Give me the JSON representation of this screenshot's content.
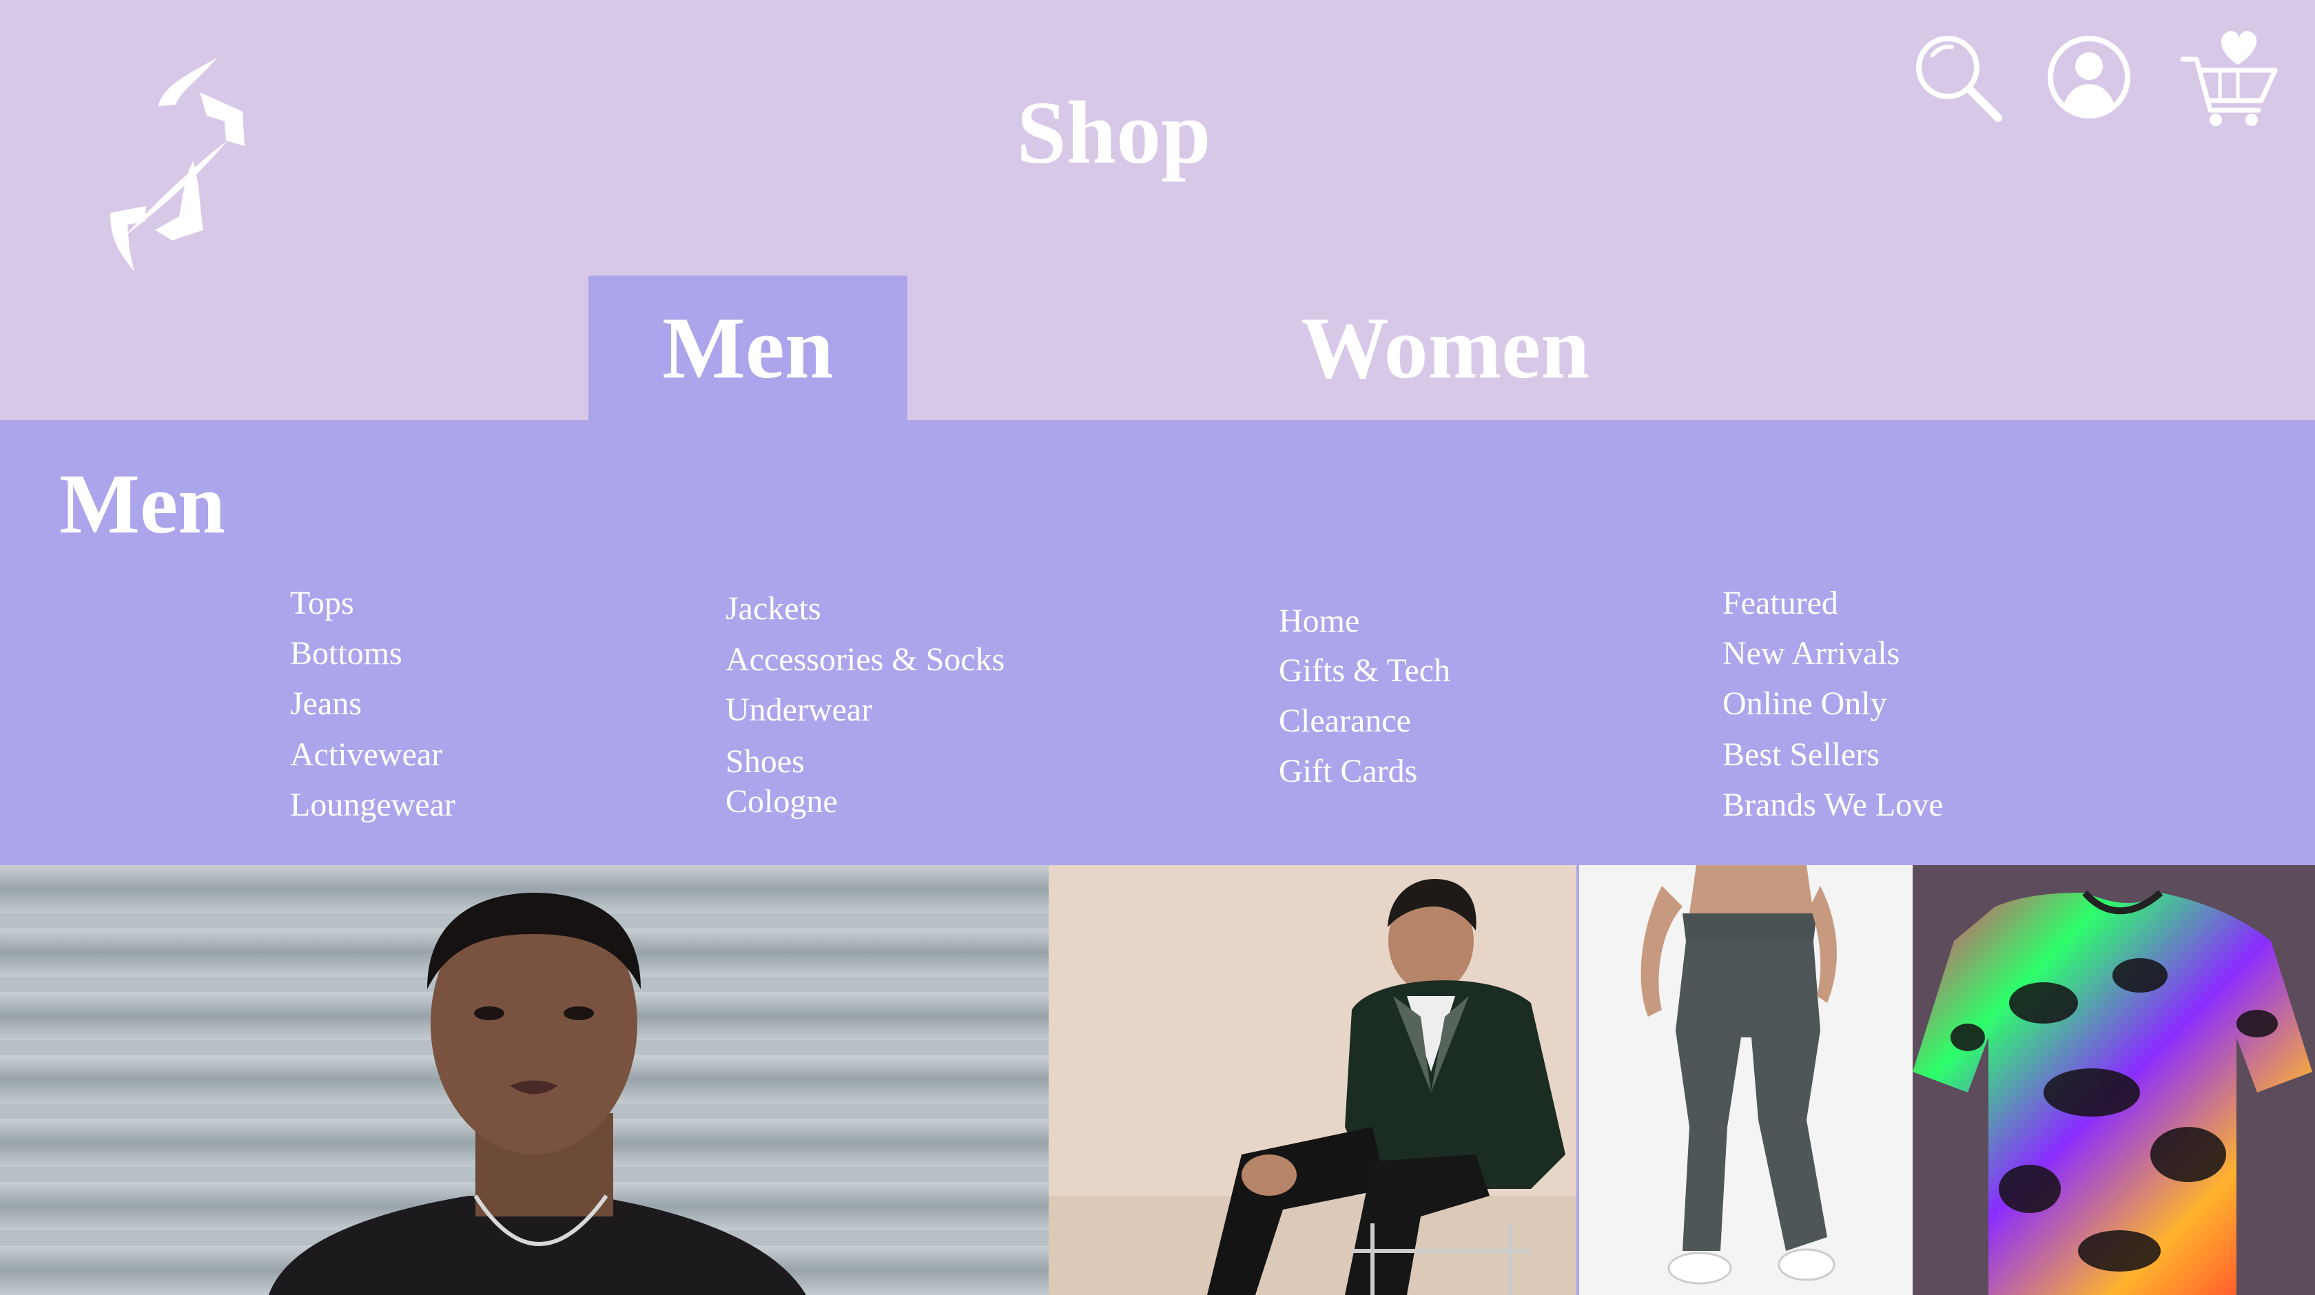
{
  "header": {
    "title": "Shop",
    "icons": [
      "logo",
      "search-icon",
      "user-icon",
      "heart-cart-icon"
    ]
  },
  "tabs": [
    {
      "label": "Men",
      "active": true
    },
    {
      "label": "Women",
      "active": false
    }
  ],
  "menu": {
    "title": "Men",
    "columns": [
      [
        "Tops",
        "Bottoms",
        "Jeans",
        "Activewear",
        "Loungewear"
      ],
      [
        "Jackets",
        "Accessories & Socks",
        "Underwear",
        "Shoes",
        "Cologne"
      ],
      [
        "Home",
        "Gifts & Tech",
        "Clearance",
        "Gift Cards"
      ],
      [
        "Featured",
        "New Arrivals",
        "Online Only",
        "Best Sellers",
        "Brands We Love"
      ]
    ]
  },
  "colors": {
    "header_bg": "#d8c8e8",
    "accent": "#ada5eb",
    "text": "#ffffff"
  },
  "photos": [
    "man-portrait-mesh-shirt",
    "man-velvet-blazer-seated",
    "grey-joggers",
    "neon-print-tshirt"
  ]
}
